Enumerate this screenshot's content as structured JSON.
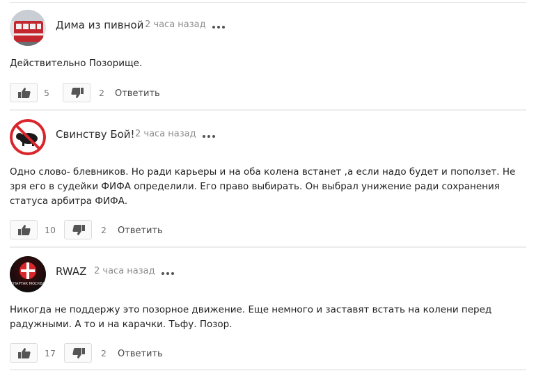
{
  "comments": [
    {
      "author": "Дима из пивной",
      "time": "2 часа назад",
      "text": "Действительно Позорище.",
      "likes": "5",
      "dislikes": "2",
      "reply": "Ответить"
    },
    {
      "author": "Свинству Бой!",
      "time": "2 часа назад",
      "text": "Одно слово- блевников. Но ради карьеры и на оба  колена встанет ,а если надо будет и  поползет. Не зря его в судейки ФИФА определили. Его право выбирать. Он выбрал унижение ради сохранения  статуса арбитра ФИФА.",
      "likes": "10",
      "dislikes": "2",
      "reply": "Ответить"
    },
    {
      "author": "RWAZ",
      "time": "2 часа назад",
      "text": "Никогда не поддержу это позорное движение. Еще немного и заставят встать на  колени перед радужными. А то и на карачки. Тьфу. Позор.",
      "likes": "17",
      "dislikes": "2",
      "reply": "Ответить",
      "avatar_text": "СПАРТАК МОСКВА"
    }
  ],
  "colors": {
    "accent_red": "#d9262c",
    "muted": "#8c8c8c",
    "border": "#dcdcdc"
  },
  "icons": {
    "like": "thumbs-up-icon",
    "dislike": "thumbs-down-icon",
    "more": "more-dots-icon"
  }
}
